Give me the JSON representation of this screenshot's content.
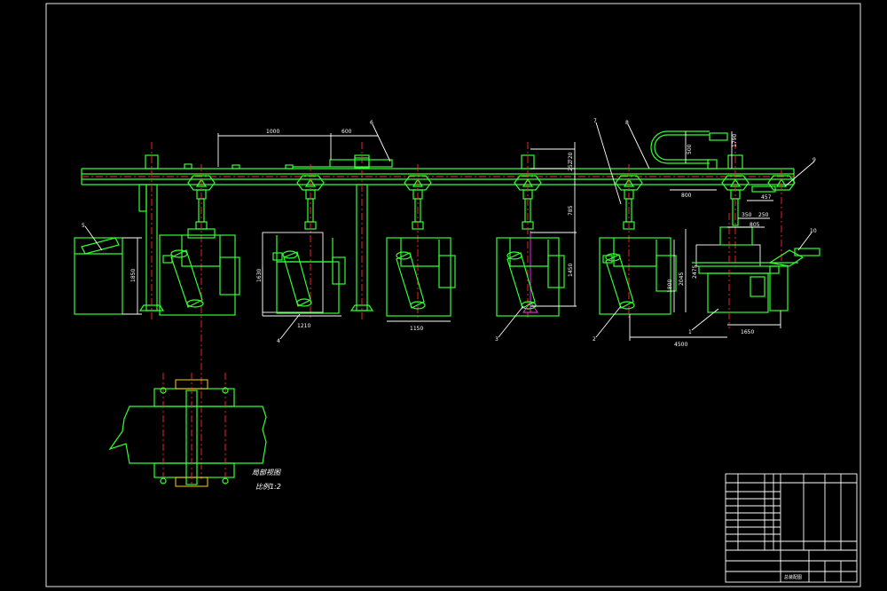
{
  "colors": {
    "background": "#000000",
    "frame": "#ffffff",
    "machine": "#33ff33",
    "centerline": "#ff2a2a",
    "accent": "#ff33ff"
  },
  "dimensions": {
    "d1000": "1000",
    "d600": "600",
    "d720": "720",
    "d1210": "1210",
    "d1150": "1150",
    "d1630": "1630",
    "d1450": "1450",
    "d2045": "2045",
    "d1800": "1800",
    "d1650": "1650",
    "d4500": "4500",
    "d785": "785",
    "d252": "252",
    "d250": "250",
    "d350": "350",
    "d805": "805",
    "d457": "457",
    "d800": "800",
    "d1790": "1790",
    "d500": "500",
    "d1850": "1850",
    "d2475": "2475"
  },
  "balloons": {
    "b1": "1",
    "b2": "2",
    "b3": "3",
    "b4": "4",
    "b5": "5",
    "b6": "6",
    "b7": "7",
    "b8": "8",
    "b9": "9",
    "b10": "10"
  },
  "detail_view": {
    "title": "局部视图",
    "scale": "比例1:2"
  },
  "title_block": {
    "drawing_name": "总装配图"
  }
}
